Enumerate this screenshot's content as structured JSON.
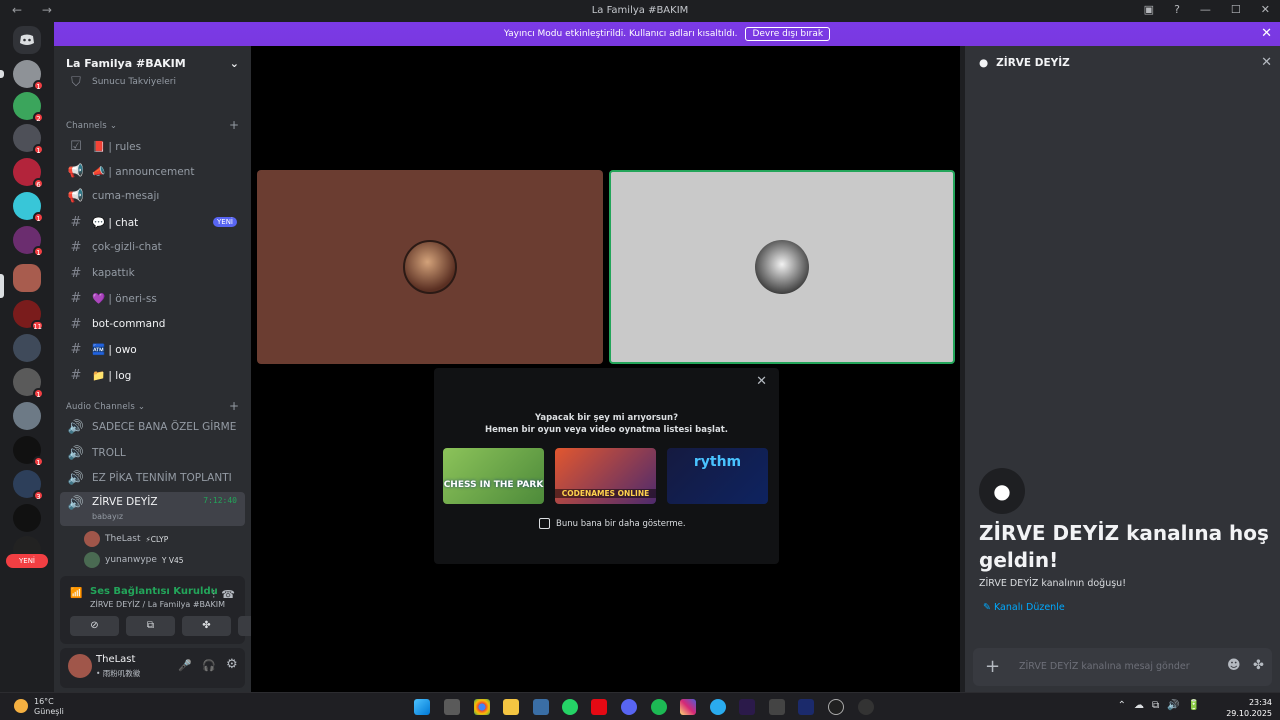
{
  "window": {
    "title": "La Familya #BAKIM",
    "nav": "← →",
    "controls": [
      "▣",
      "?",
      "—",
      "☐",
      "✕"
    ]
  },
  "banner": {
    "text": "Yayıncı Modu etkinleştirildi. Kullanıcı adları kısaltıldı.",
    "button_label": "Devre dışı bırak",
    "close": "✕"
  },
  "servers": {
    "badges": [
      "1",
      "2",
      "1",
      "6",
      "1",
      "1",
      "11",
      "1",
      "1",
      "3"
    ],
    "new_label": "YENİ"
  },
  "guild": {
    "name": "La Familya #BAKIM",
    "chevron": "⌄",
    "boosts": "Sunucu Takviyeleri",
    "channels_category": "Channels ⌄",
    "audio_category": "Audio Channels ⌄",
    "text_channels": [
      {
        "icon": "☑",
        "name": "📕 | rules"
      },
      {
        "icon": "📢",
        "name": "📣 | announcement"
      },
      {
        "icon": "📢",
        "name": "cuma-mesajı"
      },
      {
        "icon": "#",
        "name": "💬 | chat",
        "badge": "YENİ"
      },
      {
        "icon": "#",
        "name": "çok-gizli-chat"
      },
      {
        "icon": "#",
        "name": "kapattık"
      },
      {
        "icon": "#",
        "name": "💜 | öneri-ss"
      },
      {
        "icon": "#",
        "name": "bot-command"
      },
      {
        "icon": "#",
        "name": "🏧 | owo"
      },
      {
        "icon": "#",
        "name": "📁 | log"
      }
    ],
    "voice_channels": [
      {
        "icon": "🔊",
        "name": "SADECE BANA ÖZEL GİRME"
      },
      {
        "icon": "🔊",
        "name": "TROLL"
      },
      {
        "icon": "🔊",
        "name": "EZ PİKA TENNİM TOPLANTI"
      },
      {
        "icon": "🔊",
        "name": "ZİRVE DEYİZ",
        "timer": "7:12:40",
        "status": "babayız"
      }
    ],
    "voice_users": [
      {
        "name": "TheLast",
        "tag": "⚡CLYP"
      },
      {
        "name": "yunanwype",
        "tag": "Y V45"
      }
    ]
  },
  "voice_panel": {
    "title": "Ses Bağlantısı Kuruldu",
    "subtitle": "ZİRVE DEYİZ / La Familya #BAKIM",
    "buttons": [
      "⊘",
      "⧉",
      "✤",
      "⚘"
    ],
    "signal": "📶",
    "wave": "⫶",
    "disconnect": "☎"
  },
  "user": {
    "name": "TheLast",
    "status": "• 雨粉叽教徽",
    "mic": "🎤",
    "headset": "🎧",
    "settings": "⚙"
  },
  "activity": {
    "close": "✕",
    "title_line1": "Yapacak bir şey mi arıyorsun?",
    "title_line2": "Hemen bir oyun veya video oynatma listesi başlat.",
    "cards": [
      "CHESS IN THE PARK",
      "CODENAMES ONLINE",
      "rythm"
    ],
    "checkbox_label": "Bunu bana bir daha gösterme."
  },
  "right_panel": {
    "channel_name": "ZİRVE DEYİZ",
    "close": "✕",
    "welcome_title": "ZİRVE DEYİZ kanalına hoş geldin!",
    "welcome_sub": "ZİRVE DEYİZ kanalının doğuşu!",
    "edit_link": "✎ Kanalı Düzenle",
    "composer_placeholder": "ZİRVE DEYİZ kanalına mesaj gönder",
    "composer_plus": "+",
    "composer_emoji": "☻",
    "composer_apps": "✤"
  },
  "taskbar": {
    "temp": "16°C",
    "weather": "Güneşli",
    "time": "23:34",
    "date": "29.10.2025",
    "tray": [
      "⌃",
      "☁",
      "⧉",
      "🔊",
      "🔋"
    ]
  },
  "colors": {
    "banner": "#7b3ae6",
    "green_accent": "#23a55a",
    "tile_left": "#6b3d31",
    "tile_right": "#c9c9c9"
  }
}
